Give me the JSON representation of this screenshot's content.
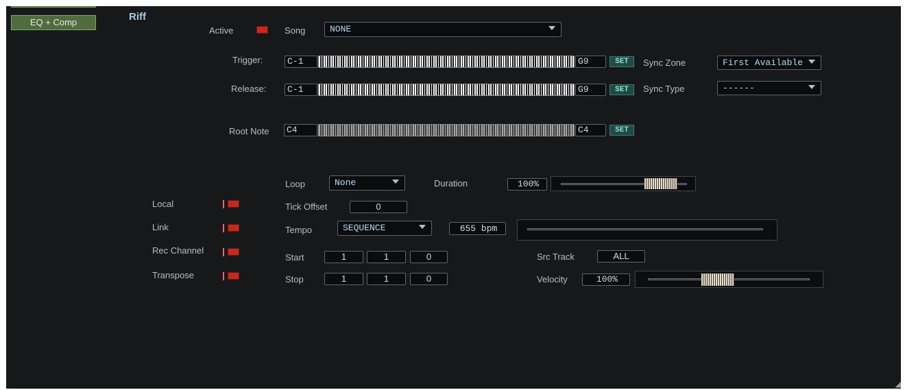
{
  "sidebar": {
    "eq_comp_label": "EQ + Comp"
  },
  "title": "Riff",
  "active": {
    "label": "Active"
  },
  "song": {
    "label": "Song",
    "value": "NONE"
  },
  "trigger": {
    "label": "Trigger:",
    "low": "C-1",
    "high": "G9",
    "set_label": "SET"
  },
  "release": {
    "label": "Release:",
    "low": "C-1",
    "high": "G9",
    "set_label": "SET"
  },
  "root_note": {
    "label": "Root Note",
    "low": "C4",
    "high": "C4",
    "set_label": "SET"
  },
  "sync_zone": {
    "label": "Sync Zone",
    "value": "First Available"
  },
  "sync_type": {
    "label": "Sync Type",
    "value": "------"
  },
  "loop": {
    "label": "Loop",
    "value": "None"
  },
  "duration": {
    "label": "Duration",
    "value": "100%",
    "position": 0.85
  },
  "tick_offset": {
    "label": "Tick Offset",
    "value": "0"
  },
  "tempo": {
    "label": "Tempo",
    "mode": "SEQUENCE",
    "bpm": "655 bpm"
  },
  "toggles": [
    {
      "label": "Local"
    },
    {
      "label": "Link"
    },
    {
      "label": "Rec Channel"
    },
    {
      "label": "Transpose"
    }
  ],
  "start": {
    "label": "Start",
    "bar": "1",
    "beat": "1",
    "tick": "0"
  },
  "stop": {
    "label": "Stop",
    "bar": "1",
    "beat": "1",
    "tick": "0"
  },
  "src_track": {
    "label": "Src Track",
    "value": "ALL"
  },
  "velocity": {
    "label": "Velocity",
    "value": "100%",
    "position": 0.43
  }
}
